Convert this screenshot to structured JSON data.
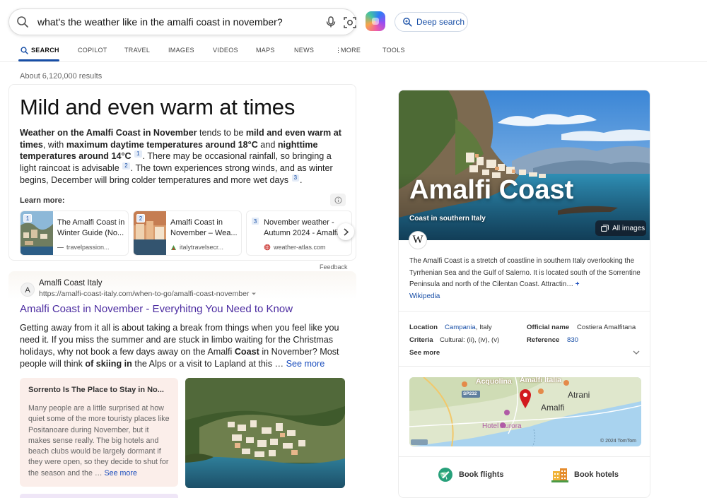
{
  "search": {
    "query": "what's the weather like in the amalfi coast in november?",
    "deep_search_label": "Deep search"
  },
  "tabs": [
    {
      "label": "SEARCH"
    },
    {
      "label": "COPILOT"
    },
    {
      "label": "TRAVEL"
    },
    {
      "label": "IMAGES"
    },
    {
      "label": "VIDEOS"
    },
    {
      "label": "MAPS"
    },
    {
      "label": "NEWS"
    },
    {
      "label": "MORE"
    },
    {
      "label": "TOOLS"
    }
  ],
  "results_count": "About 6,120,000 results",
  "answer": {
    "title": "Mild and even warm at times",
    "body": {
      "p1_b": "Weather on the Amalfi Coast in November",
      "p1_t1": " tends to be ",
      "p1_b2": "mild and even warm at times",
      "p1_t2": ", with ",
      "p1_b3": "maximum daytime temperatures around 18°C",
      "p1_t3": " and ",
      "p1_b4": "nighttime temperatures around 14°C",
      "cite1": "1",
      "p1_t4": ". There may be occasional rainfall, so bringing a light raincoat is advisable",
      "cite2": "2",
      "p1_t5": ". The town experiences strong winds, and as winter begins, December will bring colder temperatures and more wet days",
      "cite3": "3",
      "p1_t6": "."
    },
    "learn_more_label": "Learn more:",
    "sources": [
      {
        "num": "1",
        "title": "The Amalfi Coast in Winter Guide (No...",
        "site": "travelpassion..."
      },
      {
        "num": "2",
        "title": "Amalfi Coast in November – Wea...",
        "site": "italytravelsecr..."
      },
      {
        "num": "3",
        "title": "November weather - Autumn 2024 - Amalfi,",
        "site": "weather-atlas.com"
      }
    ],
    "feedback_label": "Feedback"
  },
  "web_result": {
    "site_initial": "A",
    "site_name": "Amalfi Coast Italy",
    "url": "https://amalfi-coast-italy.com/when-to-go/amalfi-coast-november",
    "title": "Amalfi Coast in November - Everyhitng You Need to Know",
    "snippet_t1": "Getting away from it all is about taking a break from things when you feel like you need it. If you miss the summer and are stuck in limbo waiting for the Christmas holidays, why not book a few days away on the Amalfi ",
    "snippet_b1": "Coast",
    "snippet_t2": " in November? Most people will think ",
    "snippet_b2": "of skiing in",
    "snippet_t3": " the Alps or a visit to Lapland at this … ",
    "see_more": "See more",
    "subcard_title": "Sorrento Is The Place to Stay in No...",
    "subcard_body": "Many people are a little surprised at how quiet some of the more touristy places like Positanoare during November, but it makes sense really. The big hotels and beach clubs would be largely dormant if they were open, so they decide to shut for the season and the … ",
    "subcard_see_more": "See more"
  },
  "knowledge_panel": {
    "title": "Amalfi Coast",
    "subtitle": "Coast in southern Italy",
    "all_images_label": "All images",
    "wiki_letter": "W",
    "description": "The Amalfi Coast is a stretch of coastline in southern Italy overlooking the Tyrrhenian Sea and the Gulf of Salerno. It is located south of the Sorrentine Peninsula and north of the Cilentan Coast. Attractin… ",
    "more_symbol": "+",
    "wiki_link": "Wikipedia",
    "facts": {
      "location_label": "Location",
      "location_link": "Campania",
      "location_rest": ", Italy",
      "official_label": "Official name",
      "official_value": "Costiera Amalfitana",
      "criteria_label": "Criteria",
      "criteria_value": "Cultural: (ii), (iv), (v)",
      "reference_label": "Reference",
      "reference_value": "830",
      "see_more": "See more"
    },
    "map": {
      "labels": [
        "Acquolina",
        "Amalfi Italia",
        "Atrani",
        "Amalfi",
        "Hotel Aurora",
        "SP232"
      ],
      "copyright": "© 2024 TomTom"
    },
    "book_flights": "Book flights",
    "book_hotels": "Book hotels"
  }
}
